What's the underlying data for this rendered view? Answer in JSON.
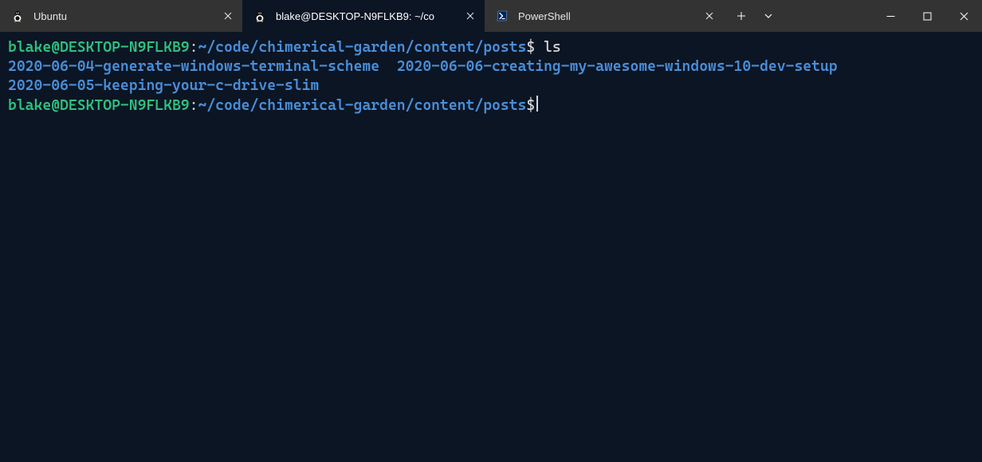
{
  "tabs": [
    {
      "label": "Ubuntu",
      "icon": "tux-icon",
      "active": false,
      "closeable": true
    },
    {
      "label": "blake@DESKTOP-N9FLKB9: ~/co",
      "icon": "tux-icon",
      "active": true,
      "closeable": true
    },
    {
      "label": "PowerShell",
      "icon": "powershell-icon",
      "active": false,
      "closeable": true
    }
  ],
  "terminal": {
    "prompt_user": "blake@DESKTOP-N9FLKB9",
    "prompt_colon": ":",
    "prompt_path": "~/code/chimerical-garden/content/posts",
    "prompt_symbol": "$",
    "command1": "ls",
    "ls_output_line1_a": "2020-06-04-generate-windows-terminal-scheme",
    "ls_output_line1_gap": "  ",
    "ls_output_line1_b": "2020-06-06-creating-my-awesome-windows-10-dev-setup",
    "ls_output_line2": "2020-06-05-keeping-your-c-drive-slim"
  },
  "colors": {
    "bg": "#0c1524",
    "tab_bg": "#333333",
    "user": "#2ec27e",
    "path": "#4a8fd9",
    "text": "#d6d6d6"
  }
}
